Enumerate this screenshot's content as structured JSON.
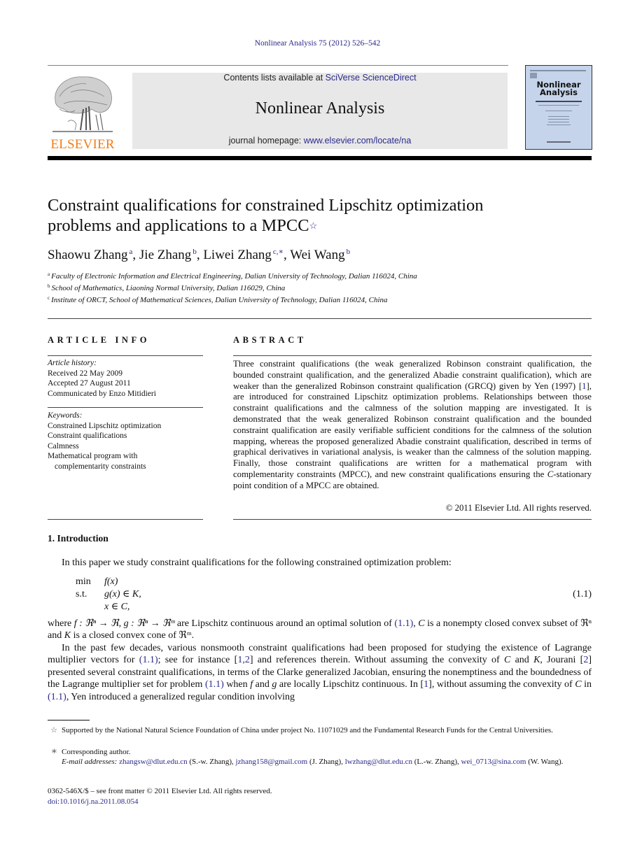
{
  "journal_reference": "Nonlinear Analysis 75 (2012) 526–542",
  "header": {
    "publisher_logo_text": "ELSEVIER",
    "contents_prefix": "Contents lists available at ",
    "contents_link": "SciVerse ScienceDirect",
    "journal_name": "Nonlinear Analysis",
    "homepage_prefix": "journal homepage: ",
    "homepage_link": "www.elsevier.com/locate/na",
    "cover_title_line1": "Nonlinear",
    "cover_title_line2": "Analysis",
    "brand_color": "#f07c1b",
    "link_color": "#2a2a8c"
  },
  "article": {
    "title_line1": "Constraint qualifications for constrained Lipschitz optimization",
    "title_line2": "problems and applications to a MPCC",
    "title_note_mark": "☆",
    "authors": [
      {
        "name": "Shaowu Zhang",
        "sup": "a"
      },
      {
        "name": "Jie Zhang",
        "sup": "b"
      },
      {
        "name": "Liwei Zhang",
        "sup": "c,∗"
      },
      {
        "name": "Wei Wang",
        "sup": "b"
      }
    ],
    "affiliations": [
      {
        "mark": "a",
        "text": "Faculty of Electronic Information and Electrical Engineering, Dalian University of Technology, Dalian 116024, China"
      },
      {
        "mark": "b",
        "text": "School of Mathematics, Liaoning Normal University, Dalian 116029, China"
      },
      {
        "mark": "c",
        "text": "Institute of ORCT, School of Mathematical Sciences, Dalian University of Technology, Dalian 116024, China"
      }
    ]
  },
  "article_info": {
    "heading": "ARTICLE INFO",
    "history_label": "Article history:",
    "received": "Received 22 May 2009",
    "accepted": "Accepted 27 August 2011",
    "communicated": "Communicated by Enzo Mitidieri",
    "keywords_label": "Keywords:",
    "keywords": [
      "Constrained Lipschitz optimization",
      "Constraint qualifications",
      "Calmness",
      "Mathematical program with",
      "complementarity constraints"
    ]
  },
  "abstract": {
    "heading": "ABSTRACT",
    "text_part1": "Three constraint qualifications (the weak generalized Robinson constraint qualification, the bounded constraint qualification, and the generalized Abadie constraint qualification), which are weaker than the generalized Robinson constraint qualification (GRCQ) given by Yen (1997) [",
    "ref1": "1",
    "text_part2": "], are introduced for constrained Lipschitz optimization problems. Relationships between those constraint qualifications and the calmness of the solution mapping are investigated. It is demonstrated that the weak generalized Robinson constraint qualification and the bounded constraint qualification are easily verifiable sufficient conditions for the calmness of the solution mapping, whereas the proposed generalized Abadie constraint qualification, described in terms of graphical derivatives in variational analysis, is weaker than the calmness of the solution mapping. Finally, those constraint qualifications are written for a mathematical program with complementarity constraints (MPCC), and new constraint qualifications ensuring the ",
    "c_italic": "C",
    "text_part3": "-stationary point condition of a MPCC are obtained.",
    "copyright": "© 2011 Elsevier Ltd. All rights reserved."
  },
  "introduction": {
    "heading": "1.  Introduction",
    "para1": "In this paper we study constraint qualifications for the following constrained optimization problem:",
    "equation": {
      "row1_op": "min",
      "row1_expr": "f(x)",
      "row2_op": "s.t.",
      "row2_expr": "g(x) ∈ K,",
      "row3_expr": "x ∈ C,",
      "number": "(1.1)"
    },
    "para2_a": "where ",
    "para2_b": "f : ℜⁿ → ℜ, g : ℜⁿ → ℜᵐ",
    "para2_c": " are Lipschitz continuous around an optimal solution of ",
    "eqref": "(1.1)",
    "para2_d": ", ",
    "para2_e": "C",
    "para2_f": " is a nonempty closed convex subset of ℜⁿ and ",
    "para2_g": "K",
    "para2_h": " is a closed convex cone of ℜᵐ.",
    "para3_a": "In the past few decades, various nonsmooth constraint qualifications had been proposed for studying the existence of Lagrange multiplier vectors for ",
    "para3_b": "; see for instance [",
    "para3_refs": "1,2",
    "para3_c": "] and references therein. Without assuming the convexity of ",
    "para3_d": " and ",
    "para3_e": ", Jourani [",
    "para3_ref2": "2",
    "para3_f": "] presented several constraint qualifications, in terms of the Clarke generalized Jacobian, ensuring the nonemptiness and the boundedness of the Lagrange multiplier set for problem ",
    "para3_g": " when ",
    "para3_h": " and ",
    "para3_i": " are locally Lipschitz continuous. In [",
    "para3_ref1": "1",
    "para3_j": "], without assuming the convexity of ",
    "para3_k": " in ",
    "para3_l": ", Yen introduced a generalized  regular condition involving",
    "var_C": "C",
    "var_K": "K",
    "var_f": "f",
    "var_g": "g"
  },
  "footnotes": {
    "star_mark": "☆",
    "star_text": "Supported by the National Natural Science Foundation of China under project No. 11071029 and the Fundamental Research Funds for the Central Universities.",
    "corr_mark": "∗",
    "corr_text": "Corresponding author.",
    "email_label": "E-mail addresses:",
    "emails": [
      {
        "addr": "zhangsw@dlut.edu.cn",
        "who": "(S.-w. Zhang)"
      },
      {
        "addr": "jzhang158@gmail.com",
        "who": "(J. Zhang)"
      },
      {
        "addr": "lwzhang@dlut.edu.cn",
        "who": "(L.-w. Zhang)"
      },
      {
        "addr": "wei_0713@sina.com",
        "who": "(W. Wang)."
      }
    ]
  },
  "front_matter": {
    "issn": "0362-546X/$ – see front matter © 2011 Elsevier Ltd. All rights reserved.",
    "doi": "doi:10.1016/j.na.2011.08.054"
  }
}
